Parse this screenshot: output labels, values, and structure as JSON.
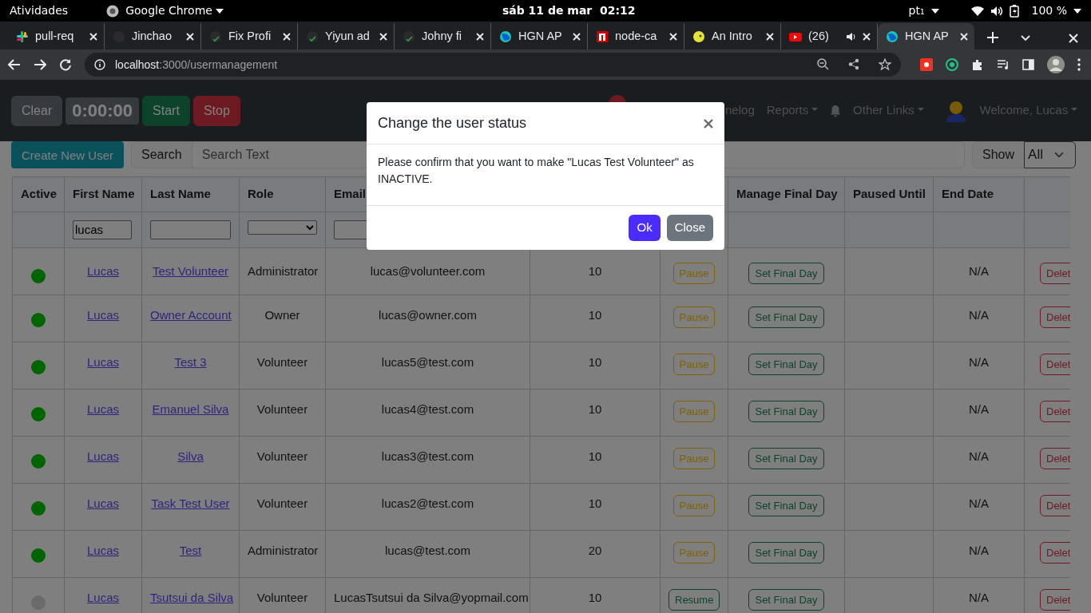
{
  "system_bar": {
    "activities": "Atividades",
    "app": "Google Chrome",
    "clock": "sáb 11 de mar  02:12",
    "keyboard": "pt₁",
    "battery": "100 %"
  },
  "browser": {
    "tabs": [
      {
        "title": "pull-req",
        "kind": "slack",
        "selected": false,
        "audio": false
      },
      {
        "title": "Jinchao",
        "kind": "github",
        "selected": false,
        "audio": false
      },
      {
        "title": "Fix Profi",
        "kind": "github-check",
        "selected": false,
        "audio": false
      },
      {
        "title": "Yiyun ad",
        "kind": "github-check",
        "selected": false,
        "audio": false
      },
      {
        "title": "Johny fi",
        "kind": "github-check",
        "selected": false,
        "audio": false
      },
      {
        "title": "HGN AP",
        "kind": "globe",
        "selected": false,
        "audio": false
      },
      {
        "title": "node-ca",
        "kind": "npm",
        "selected": false,
        "audio": false
      },
      {
        "title": "An Intro",
        "kind": "smiley",
        "selected": false,
        "audio": false
      },
      {
        "title": "(26)",
        "kind": "video",
        "selected": false,
        "audio": true
      },
      {
        "title": "HGN AP",
        "kind": "globe",
        "selected": true,
        "audio": false
      }
    ],
    "address": {
      "host": "localhost",
      "path": ":3000/usermanagement"
    }
  },
  "navbar": {
    "timer": [
      {
        "label": "Clear",
        "kind": "clear"
      },
      {
        "label": "0:00:00",
        "kind": "display"
      },
      {
        "label": "Start",
        "kind": "start"
      },
      {
        "label": "Stop",
        "kind": "stop"
      }
    ],
    "items": [
      {
        "kind": "badge"
      },
      {
        "kind": "link",
        "label": "nelog",
        "dropdown": false
      },
      {
        "kind": "link",
        "label": "Reports",
        "dropdown": true
      },
      {
        "kind": "bell"
      },
      {
        "kind": "link",
        "label": "Other Links",
        "dropdown": true
      },
      {
        "kind": "avatar"
      },
      {
        "kind": "link",
        "label": "Welcome, Lucas",
        "dropdown": true
      }
    ]
  },
  "toolbar": {
    "create": "Create New User",
    "search_label": "Search",
    "search_placeholder": "Search Text",
    "show_label": "Show",
    "show_value": "All"
  },
  "table": {
    "columns_left": [
      "Active",
      "First Name",
      "Last Name",
      "Role",
      "Email"
    ],
    "columns_right": [
      "Manage Final Day",
      "Paused Until",
      "End Date"
    ],
    "filter_first_name": "lucas",
    "rows": [
      {
        "active": true,
        "first": "Lucas",
        "last": "Test Volunteer",
        "role": "Administrator",
        "email": "lucas@volunteer.com",
        "hours": "10",
        "pause": "Pause",
        "paused": false,
        "final": "Set Final Day",
        "end": "N/A",
        "delete": "Delet"
      },
      {
        "active": true,
        "first": "Lucas",
        "last": "Owner Account",
        "role": "Owner",
        "email": "lucas@owner.com",
        "hours": "10",
        "pause": "Pause",
        "paused": false,
        "final": "Set Final Day",
        "end": "N/A",
        "delete": "Delet"
      },
      {
        "active": true,
        "first": "Lucas",
        "last": "Test 3",
        "role": "Volunteer",
        "email": "lucas5@test.com",
        "hours": "10",
        "pause": "Pause",
        "paused": false,
        "final": "Set Final Day",
        "end": "N/A",
        "delete": "Delet"
      },
      {
        "active": true,
        "first": "Lucas",
        "last": "Emanuel Silva",
        "role": "Volunteer",
        "email": "lucas4@test.com",
        "hours": "10",
        "pause": "Pause",
        "paused": false,
        "final": "Set Final Day",
        "end": "N/A",
        "delete": "Delet"
      },
      {
        "active": true,
        "first": "Lucas",
        "last": "Silva",
        "role": "Volunteer",
        "email": "lucas3@test.com",
        "hours": "10",
        "pause": "Pause",
        "paused": false,
        "final": "Set Final Day",
        "end": "N/A",
        "delete": "Delet"
      },
      {
        "active": true,
        "first": "Lucas",
        "last": "Task Test User",
        "role": "Volunteer",
        "email": "lucas2@test.com",
        "hours": "10",
        "pause": "Pause",
        "paused": false,
        "final": "Set Final Day",
        "end": "N/A",
        "delete": "Delet"
      },
      {
        "active": true,
        "first": "Lucas",
        "last": "Test",
        "role": "Administrator",
        "email": "lucas@test.com",
        "hours": "20",
        "pause": "Pause",
        "paused": false,
        "final": "Set Final Day",
        "end": "N/A",
        "delete": "Delet"
      },
      {
        "active": false,
        "first": "Lucas",
        "last": "Tsutsui da Silva",
        "role": "Volunteer",
        "email": "LucasTsutsui da Silva@yopmail.com",
        "hours": "10",
        "pause": "Resume",
        "paused": true,
        "final": "Set Final Day",
        "end": "N/A",
        "delete": "Delet"
      }
    ]
  },
  "modal": {
    "title": "Change the user status",
    "body": "Please confirm that you want to make \"Lucas Test Volunteer\" as INACTIVE.",
    "buttons": [
      {
        "label": "Ok",
        "kind": "primary"
      },
      {
        "label": "Close",
        "kind": "secondary"
      }
    ]
  }
}
